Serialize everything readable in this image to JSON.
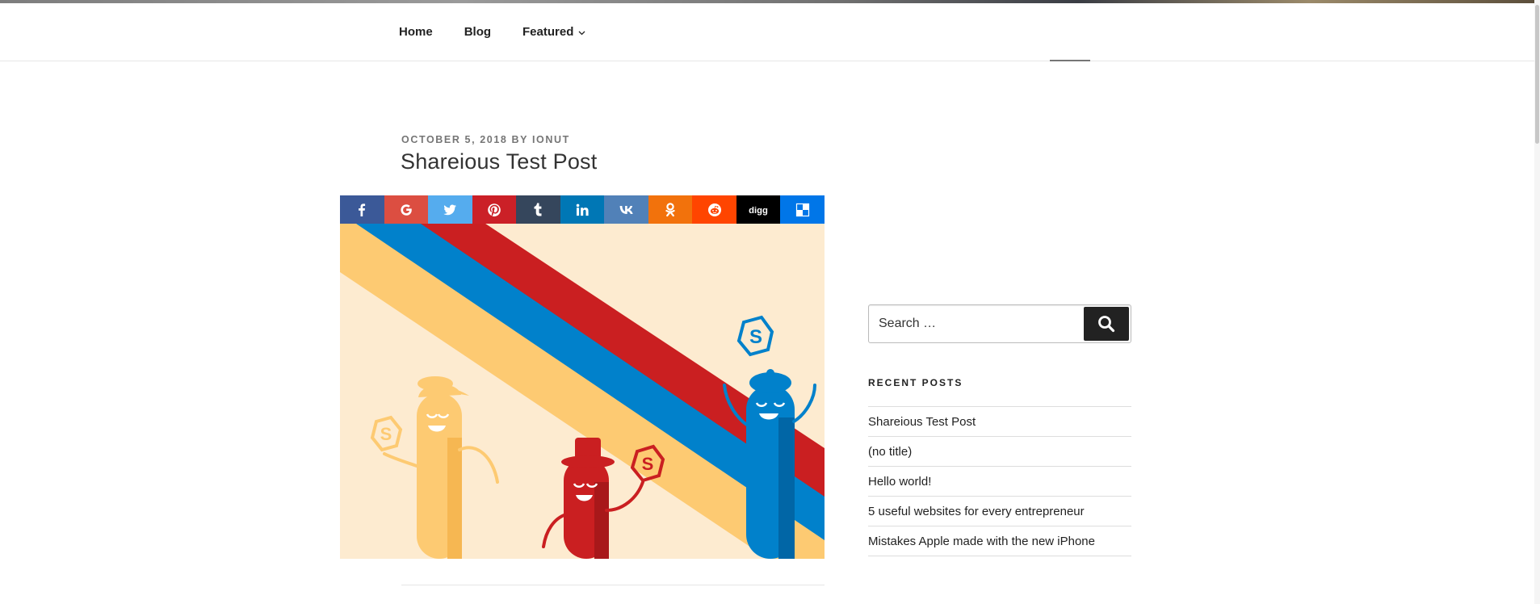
{
  "nav": {
    "items": [
      {
        "label": "Home"
      },
      {
        "label": "Blog"
      },
      {
        "label": "Featured",
        "has_submenu": true
      }
    ]
  },
  "post": {
    "date": "October 5, 2018",
    "by": "by",
    "author": "Ionut",
    "title": "Shareious Test Post"
  },
  "share_buttons": [
    {
      "network": "facebook-icon",
      "color": "#3b5998"
    },
    {
      "network": "google-icon",
      "color": "#dc4e41"
    },
    {
      "network": "twitter-icon",
      "color": "#55acee"
    },
    {
      "network": "pinterest-icon",
      "color": "#cb2027"
    },
    {
      "network": "tumblr-icon",
      "color": "#35465c"
    },
    {
      "network": "linkedin-icon",
      "color": "#0077b5"
    },
    {
      "network": "vk-icon",
      "color": "#5181b8"
    },
    {
      "network": "odnoklassniki-icon",
      "color": "#f2720c"
    },
    {
      "network": "reddit-icon",
      "color": "#ff4500"
    },
    {
      "network": "digg-icon",
      "color": "#000000",
      "text": "digg"
    },
    {
      "network": "delicious-icon",
      "color": "#0076e8"
    }
  ],
  "sidebar": {
    "search": {
      "placeholder": "Search …",
      "button": "search-icon"
    },
    "recent_posts": {
      "title": "Recent Posts",
      "items": [
        {
          "label": "Shareious Test Post"
        },
        {
          "label": "(no title)"
        },
        {
          "label": "Hello world!"
        },
        {
          "label": "5 useful websites for every entrepreneur"
        },
        {
          "label": "Mistakes Apple made with the new iPhone"
        }
      ]
    }
  },
  "colors": {
    "hero_bg": "#fdebd0",
    "stripe_yellow": "#fdca72",
    "stripe_blue": "#0181cb",
    "stripe_red": "#ca1f21"
  }
}
